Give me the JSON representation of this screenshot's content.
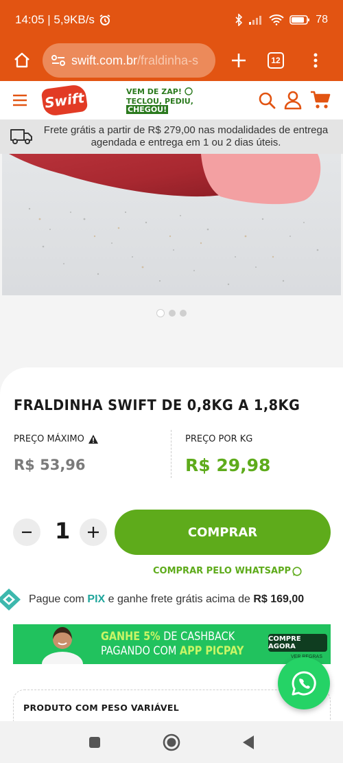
{
  "status_bar": {
    "time_speed": "14:05 | 5,9KB/s",
    "battery": "78"
  },
  "browser": {
    "url_host": "swift.com.br",
    "url_path": "/fraldinha-s",
    "tab_count": "12"
  },
  "site_header": {
    "logo_text": "Swift",
    "zap_line1": "VEM DE ZAP!",
    "zap_line2": "TECLOU, PEDIU,",
    "zap_line3": "CHEGOU!"
  },
  "shipping_banner": {
    "text": "Frete grátis a partir de R$ 279,00 nas modalidades de entrega agendada e entrega em 1 ou 2 dias úteis."
  },
  "product": {
    "title": "FRALDINHA SWIFT DE 0,8KG A 1,8KG",
    "price_max_label": "PREÇO MÁXIMO",
    "price_max_value": "R$ 53,96",
    "price_kg_label": "PREÇO POR KG",
    "price_kg_value": "R$ 29,98",
    "quantity": "1",
    "buy_label": "COMPRAR",
    "whatsapp_label": "COMPRAR PELO WHATSAPP"
  },
  "pix": {
    "prefix": "Pague com ",
    "pix": "PIX",
    "middle": " e ganhe frete grátis acima de ",
    "amount": "R$ 169,00"
  },
  "cashback": {
    "line1_bold": "GANHE 5%",
    "line1_rest": " DE CASHBACK",
    "line2_plain": "PAGANDO COM ",
    "line2_bold": "APP PICPAY",
    "button": "COMPRE AGORA",
    "rules": "VER REGRAS"
  },
  "weight_box": {
    "title": "PRODUTO COM PESO VARIÁVEL"
  },
  "colors": {
    "brand_orange": "#e25412",
    "green": "#5eab1b",
    "pix_teal": "#1fa59b",
    "whatsapp": "#25d366"
  },
  "icons": [
    "home-icon",
    "site-settings-icon",
    "plus-icon",
    "tabs-icon",
    "menu-dots-icon",
    "hamburger-icon",
    "search-icon",
    "user-icon",
    "cart-icon",
    "truck-icon",
    "warning-icon",
    "whatsapp-icon",
    "pix-icon"
  ]
}
